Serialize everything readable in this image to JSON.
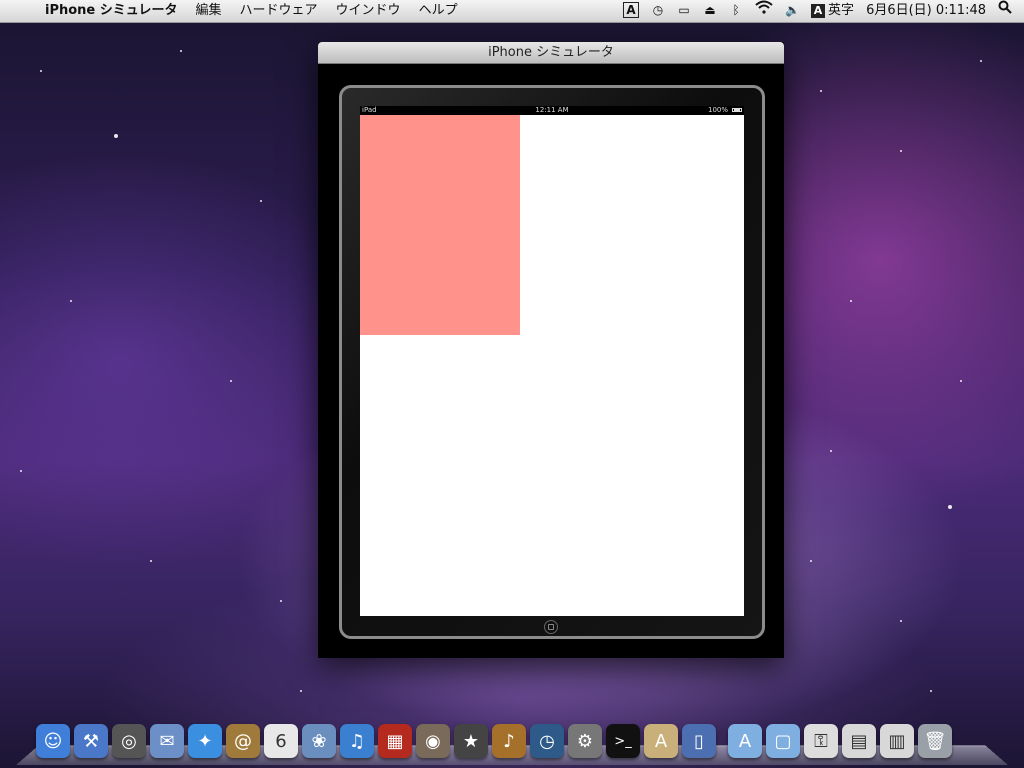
{
  "menubar": {
    "app_name": "iPhone シミュレータ",
    "menus": [
      "編集",
      "ハードウェア",
      "ウインドウ",
      "ヘルプ"
    ],
    "input_mode_label": "A",
    "input_mode": "英字",
    "datetime": "6月6日(日)  0:11:48"
  },
  "window": {
    "title": "iPhone シミュレータ"
  },
  "device_status": {
    "carrier": "iPad",
    "time": "12:11 AM",
    "battery": "100%"
  },
  "app_view": {
    "rect_color": "#ff938b",
    "background_color": "#ffffff"
  },
  "dock": {
    "icons": [
      {
        "name": "finder-icon",
        "glyph": "☺",
        "color": "#3f7fd9"
      },
      {
        "name": "xcode-icon",
        "glyph": "⚒",
        "color": "#4a77c8"
      },
      {
        "name": "instruments-icon",
        "glyph": "◎",
        "color": "#555"
      },
      {
        "name": "mail-icon",
        "glyph": "✉",
        "color": "#6d8fc8"
      },
      {
        "name": "safari-icon",
        "glyph": "✦",
        "color": "#3a8fe0"
      },
      {
        "name": "address-book-icon",
        "glyph": "@",
        "color": "#a07a3a"
      },
      {
        "name": "ical-icon",
        "glyph": "6",
        "color": "#e8e8e8"
      },
      {
        "name": "iphoto-icon",
        "glyph": "❀",
        "color": "#6a8fbf"
      },
      {
        "name": "itunes-icon",
        "glyph": "♫",
        "color": "#3a7fd0"
      },
      {
        "name": "photo-booth-icon",
        "glyph": "▦",
        "color": "#b42a1e"
      },
      {
        "name": "image-capture-icon",
        "glyph": "◉",
        "color": "#7a6a5a"
      },
      {
        "name": "imovie-icon",
        "glyph": "★",
        "color": "#444"
      },
      {
        "name": "garageband-icon",
        "glyph": "♪",
        "color": "#a5702a"
      },
      {
        "name": "time-machine-icon",
        "glyph": "◷",
        "color": "#2e5a8a"
      },
      {
        "name": "system-preferences-icon",
        "glyph": "⚙",
        "color": "#777"
      },
      {
        "name": "terminal-icon",
        "glyph": ">_",
        "color": "#111"
      },
      {
        "name": "interface-builder-icon",
        "glyph": "A",
        "color": "#c9b07a"
      },
      {
        "name": "simulator-icon",
        "glyph": "▯",
        "color": "#4b6fb0"
      },
      {
        "name": "applications-folder-icon",
        "glyph": "A",
        "color": "#7faee0"
      },
      {
        "name": "documents-folder-icon",
        "glyph": "▢",
        "color": "#7faee0"
      },
      {
        "name": "archive-icon",
        "glyph": "⚿",
        "color": "#ddd"
      },
      {
        "name": "downloads-stack-icon",
        "glyph": "▤",
        "color": "#d8d8d8"
      },
      {
        "name": "window-stack-icon",
        "glyph": "▥",
        "color": "#d8d8d8"
      },
      {
        "name": "trash-icon",
        "glyph": "🗑",
        "color": "#9aa0a8"
      }
    ]
  }
}
